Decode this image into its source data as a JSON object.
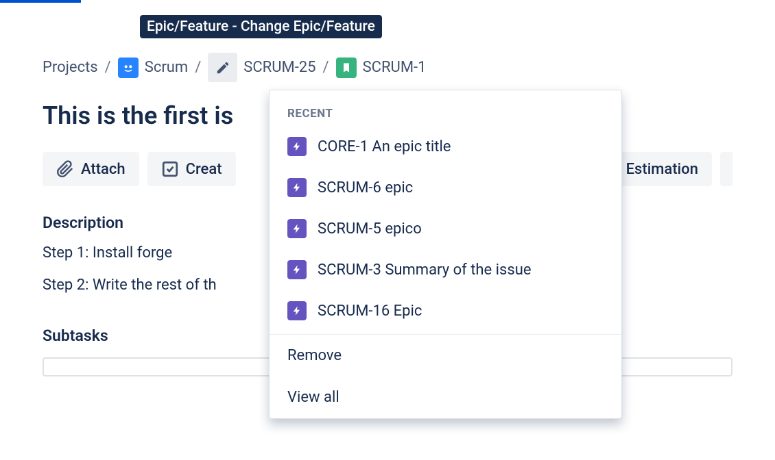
{
  "tooltip": "Epic/Feature - Change Epic/Feature",
  "breadcrumb": {
    "projects": "Projects",
    "project_name": "Scrum",
    "parent_key": "SCRUM-25",
    "issue_key": "SCRUM-1"
  },
  "issue_title": "This is the first is",
  "actions": {
    "attach": "Attach",
    "create": "Creat",
    "estimation": "Estimation"
  },
  "description": {
    "heading": "Description",
    "step1": "Step 1: Install forge",
    "step2": "Step 2: Write the rest of th"
  },
  "subtasks_heading": "Subtasks",
  "dropdown": {
    "recent_label": "RECENT",
    "items": [
      {
        "label": "CORE-1 An epic title"
      },
      {
        "label": "SCRUM-6 epic"
      },
      {
        "label": "SCRUM-5 epico"
      },
      {
        "label": "SCRUM-3 Summary of the issue"
      },
      {
        "label": "SCRUM-16 Epic"
      }
    ],
    "remove": "Remove",
    "view_all": "View all"
  }
}
